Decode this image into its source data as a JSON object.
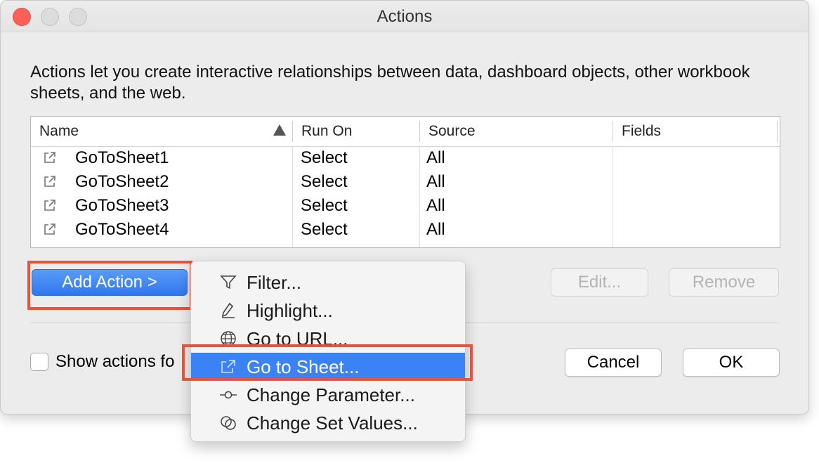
{
  "window": {
    "title": "Actions"
  },
  "description": "Actions let you create interactive relationships between data, dashboard objects, other workbook sheets, and the web.",
  "table": {
    "columns": [
      "Name",
      "Run On",
      "Source",
      "Fields"
    ],
    "sort_icon": "sort-ascending-icon",
    "rows": [
      {
        "name": "GoToSheet1",
        "run_on": "Select",
        "source": "All",
        "fields": ""
      },
      {
        "name": "GoToSheet2",
        "run_on": "Select",
        "source": "All",
        "fields": ""
      },
      {
        "name": "GoToSheet3",
        "run_on": "Select",
        "source": "All",
        "fields": ""
      },
      {
        "name": "GoToSheet4",
        "run_on": "Select",
        "source": "All",
        "fields": ""
      }
    ],
    "row_icon": "go-to-sheet-icon"
  },
  "buttons": {
    "add_action": "Add Action >",
    "edit": "Edit...",
    "remove": "Remove",
    "cancel": "Cancel",
    "ok": "OK"
  },
  "checkbox": {
    "label": "Show actions fo",
    "checked": false
  },
  "menu": {
    "items": [
      {
        "label": "Filter...",
        "icon": "filter-icon",
        "active": false
      },
      {
        "label": "Highlight...",
        "icon": "highlight-pen-icon",
        "active": false
      },
      {
        "label": "Go to URL...",
        "icon": "globe-icon",
        "active": false
      },
      {
        "label": "Go to Sheet...",
        "icon": "go-to-sheet-icon",
        "active": true
      },
      {
        "label": "Change Parameter...",
        "icon": "parameter-icon",
        "active": false
      },
      {
        "label": "Change Set Values...",
        "icon": "set-values-icon",
        "active": false
      }
    ]
  },
  "colors": {
    "accent": "#3b82f6",
    "annotation": "#e8543b",
    "close_light": "#fe5f57"
  }
}
